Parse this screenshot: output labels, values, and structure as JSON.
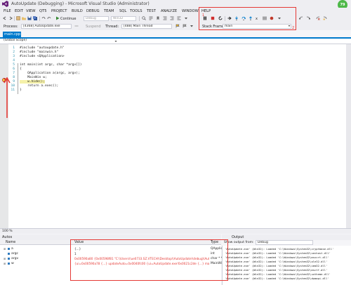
{
  "window": {
    "title": "AutoUpdate (Debugging) - Microsoft Visual Studio (Administrator)",
    "badge": "79"
  },
  "menu": [
    "FILE",
    "EDIT",
    "VIEW",
    "QT5",
    "PROJECT",
    "BUILD",
    "DEBUG",
    "TEAM",
    "SQL",
    "TOOLS",
    "TEST",
    "ANALYZE",
    "WINDOW",
    "HELP"
  ],
  "toolbar": {
    "continue_label": "Continue",
    "config_value": "Debug",
    "platform_value": "Win32",
    "process_label": "Process:",
    "process_value": "[4368] AutoUpdate.exe",
    "suspend_label": "Suspend",
    "thread_label": "Thread:",
    "thread_value": "[488] Main Thread",
    "stack_frame_label": "Stack Frame:",
    "stack_frame_value": "main",
    "annotation_1": "1",
    "annotation_2": "2"
  },
  "document": {
    "tab_label": "main.cpp",
    "scope": "(Global Scope)"
  },
  "code": {
    "lines": [
      {
        "n": "1",
        "text": "#include \"autoupdate.h\""
      },
      {
        "n": "2",
        "text": "#include \"mainwin.h\""
      },
      {
        "n": "3",
        "text": "#include <QApplication>"
      },
      {
        "n": "4",
        "text": ""
      },
      {
        "n": "5",
        "text": "int main(int argc, char *argv[])"
      },
      {
        "n": "6",
        "text": "{"
      },
      {
        "n": "7",
        "text": "    QApplication a(argc, argv);"
      },
      {
        "n": "8",
        "text": "    MainWin w;"
      },
      {
        "n": "9",
        "text": "    w.hide();"
      },
      {
        "n": "10",
        "text": "    return a.exec();"
      },
      {
        "n": "11",
        "text": "}"
      }
    ]
  },
  "zoom": "100 %",
  "autos": {
    "title": "Autos",
    "columns": [
      "Name",
      "Value",
      "Type"
    ],
    "rows": [
      {
        "name": "a",
        "value": "{...}",
        "type": "QApplica"
      },
      {
        "name": "argc",
        "value": "1",
        "type": "int"
      },
      {
        "name": "argv",
        "value": "0x00590a80 {0x00598f81 \"C:\\\\Users\\\\ue0733.SZ.VTECH\\\\Desktop\\\\AutoUpdate\\\\debug\\\\AutoUpdate.exe\"}",
        "type": "char * *"
      },
      {
        "name": "w",
        "value": "{ui=0x00590a78 {...} updateAuto=0x0040fc00 {ui=AutoUpdate.exe!0x0021c2de {...} manager=0x00...",
        "type": "MainWin"
      }
    ]
  },
  "output": {
    "title": "Output",
    "show_from_label": "Show output from:",
    "show_from_value": "Debug",
    "lines": [
      "'AutoUpdate.exe' (Win32): Loaded 'C:\\Windows\\System32\\cryptbase.dll'",
      "'AutoUpdate.exe' (Win32): Loaded 'C:\\Windows\\System32\\sechost.dll'",
      "'AutoUpdate.exe' (Win32): Loaded 'C:\\Windows\\System32\\msvcrt.dll'",
      "'AutoUpdate.exe' (Win32): Loaded 'C:\\Windows\\System32\\ole32.dll'",
      "'AutoUpdate.exe' (Win32): Loaded 'C:\\Windows\\System32\\imm32.dll'",
      "'AutoUpdate.exe' (Win32): Loaded 'C:\\Windows\\System32\\msctf.dll'",
      "'AutoUpdate.exe' (Win32): Loaded 'C:\\Windows\\System32\\uxtheme.dll'",
      "'AutoUpdate.exe' (Win32): Loaded 'C:\\Windows\\System32\\dwmapi.dll'"
    ]
  },
  "colors": {
    "accent": "#007acc",
    "annotation": "#e53935",
    "breakpoint": "#c0392b"
  }
}
